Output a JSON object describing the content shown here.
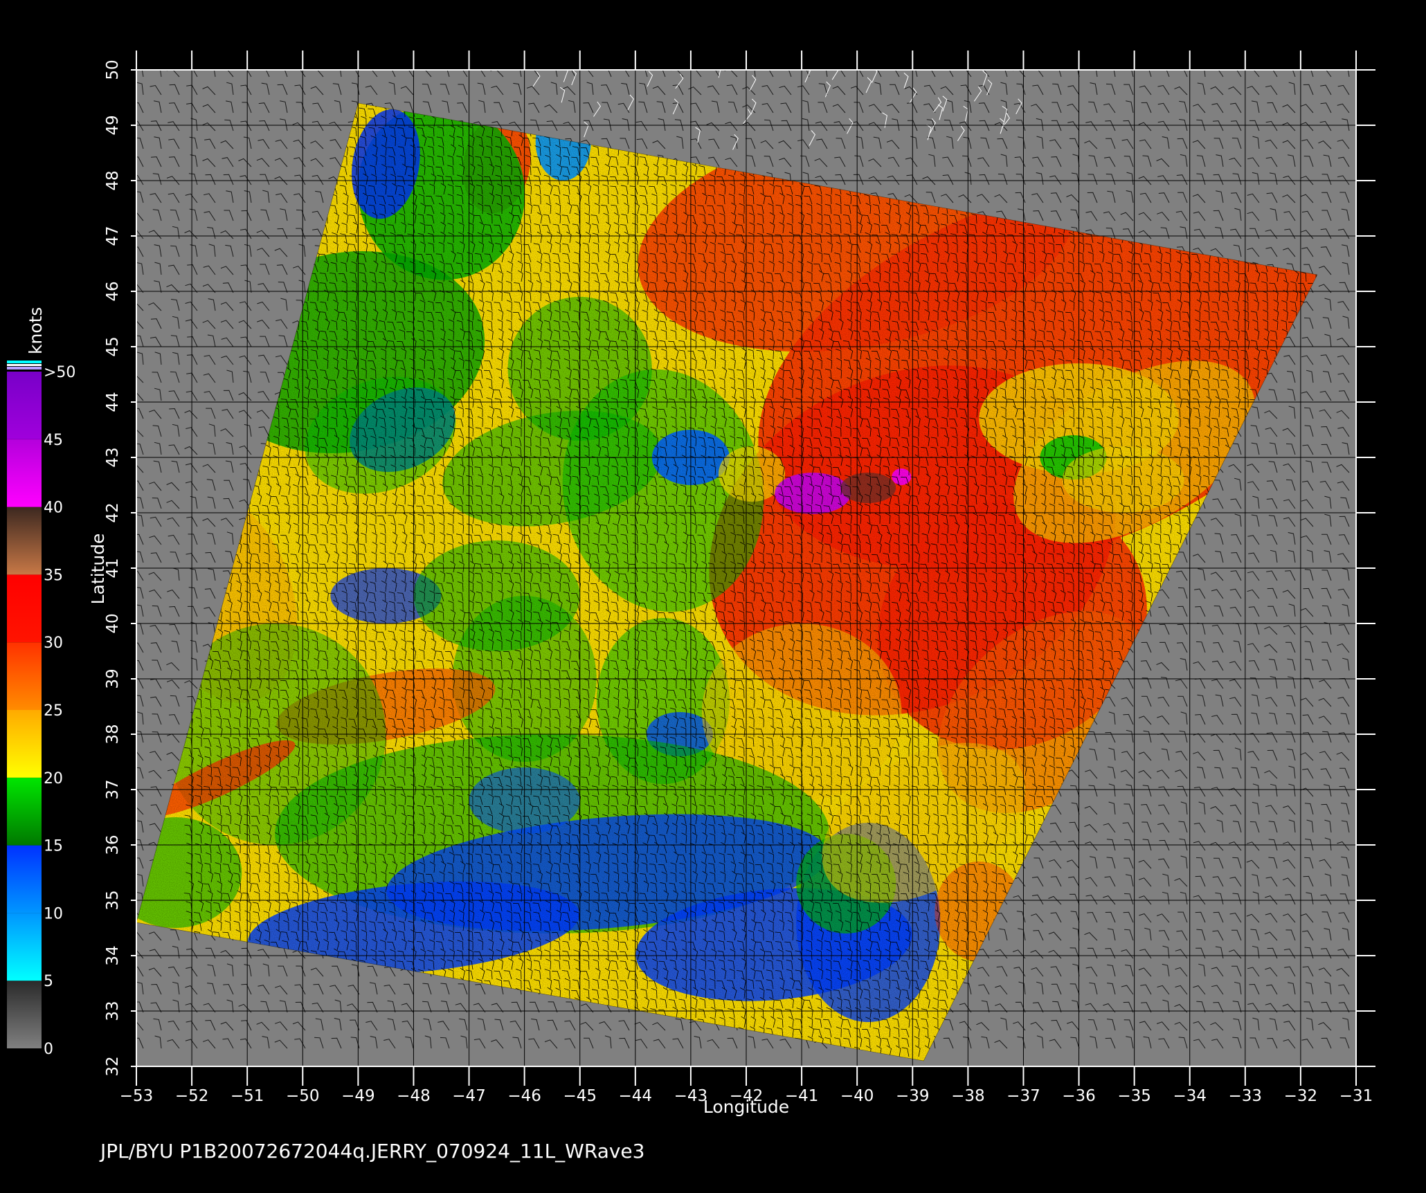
{
  "map": {
    "x_axis_label": "Longitude",
    "y_axis_label": "Latitude",
    "longitude_ticks": [
      "-53",
      "-52",
      "-51",
      "-50",
      "-49",
      "-48",
      "-47",
      "-46",
      "-45",
      "-44",
      "-43",
      "-42",
      "-41",
      "-40",
      "-39",
      "-38",
      "-37",
      "-36",
      "-35",
      "-34",
      "-33",
      "-32",
      "-31"
    ],
    "latitude_ticks": [
      "32",
      "33",
      "34",
      "35",
      "36",
      "37",
      "38",
      "39",
      "40",
      "41",
      "42",
      "43",
      "44",
      "45",
      "46",
      "47",
      "48",
      "49",
      "50"
    ],
    "footer": "JPL/BYU  P1B20072672044q.JERRY_070924_11L_WRave3",
    "land_color": "#808080",
    "background_color": "#000000",
    "legend": {
      "title": "knots",
      "tick_labels": [
        "0",
        "5",
        "10",
        "15",
        "20",
        "25",
        "30",
        "35",
        "40",
        "45",
        ">50"
      ],
      "colors": [
        {
          "from": 0,
          "to": 5,
          "start": "#808080",
          "end": "#2a2a2a"
        },
        {
          "from": 5,
          "to": 10,
          "start": "#00ffff",
          "end": "#0096ff"
        },
        {
          "from": 10,
          "to": 15,
          "start": "#0096ff",
          "end": "#0032ff"
        },
        {
          "from": 15,
          "to": 20,
          "start": "#007800",
          "end": "#00e600"
        },
        {
          "from": 20,
          "to": 25,
          "start": "#ffff00",
          "end": "#ffaa00"
        },
        {
          "from": 25,
          "to": 30,
          "start": "#ff8c00",
          "end": "#ff3200"
        },
        {
          "from": 30,
          "to": 35,
          "start": "#ff1400",
          "end": "#ff0000"
        },
        {
          "from": 35,
          "to": 40,
          "start": "#c87846",
          "end": "#3c2820"
        },
        {
          "from": 40,
          "to": 45,
          "start": "#ff00ff",
          "end": "#b400dc"
        },
        {
          "from": 45,
          "to": 50,
          "start": "#a000dc",
          "end": "#7800c8"
        }
      ]
    },
    "storm_center": {
      "lon": -40.3,
      "lat": 42.4
    },
    "swath_corners": [
      {
        "lon": -49.0,
        "lat": 49.4
      },
      {
        "lon": -31.7,
        "lat": 46.3
      },
      {
        "lon": -38.8,
        "lat": 32.1
      },
      {
        "lon": -53.0,
        "lat": 34.6
      }
    ]
  }
}
